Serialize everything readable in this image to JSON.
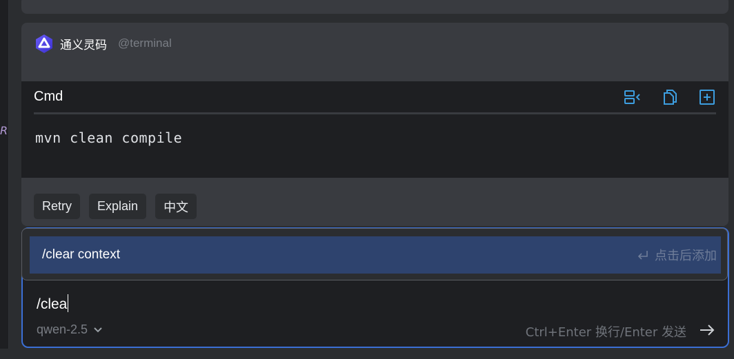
{
  "gutter": {
    "letter": "R"
  },
  "message": {
    "assistant_name": "通义灵码",
    "mention": "@terminal",
    "icons": {
      "logo": "tongyi-lingma-logo-icon"
    }
  },
  "code_block": {
    "language": "Cmd",
    "code": "mvn clean compile",
    "actions": {
      "insert": "insert-to-terminal-icon",
      "copy": "copy-icon",
      "new_file": "new-file-icon"
    }
  },
  "quick_actions": [
    {
      "label": "Retry"
    },
    {
      "label": "Explain"
    },
    {
      "label": "中文"
    }
  ],
  "suggestion": {
    "label": "/clear context",
    "hint": "点击后添加",
    "hint_icon": "enter-return-icon"
  },
  "input": {
    "value": "/clea",
    "model": "qwen-2.5",
    "send_hint": "Ctrl+Enter 换行/Enter 发送",
    "send_icon": "arrow-right-icon"
  },
  "colors": {
    "accent": "#3b6fd6",
    "selection": "#2e436e",
    "icon": "#3d9ee0"
  }
}
